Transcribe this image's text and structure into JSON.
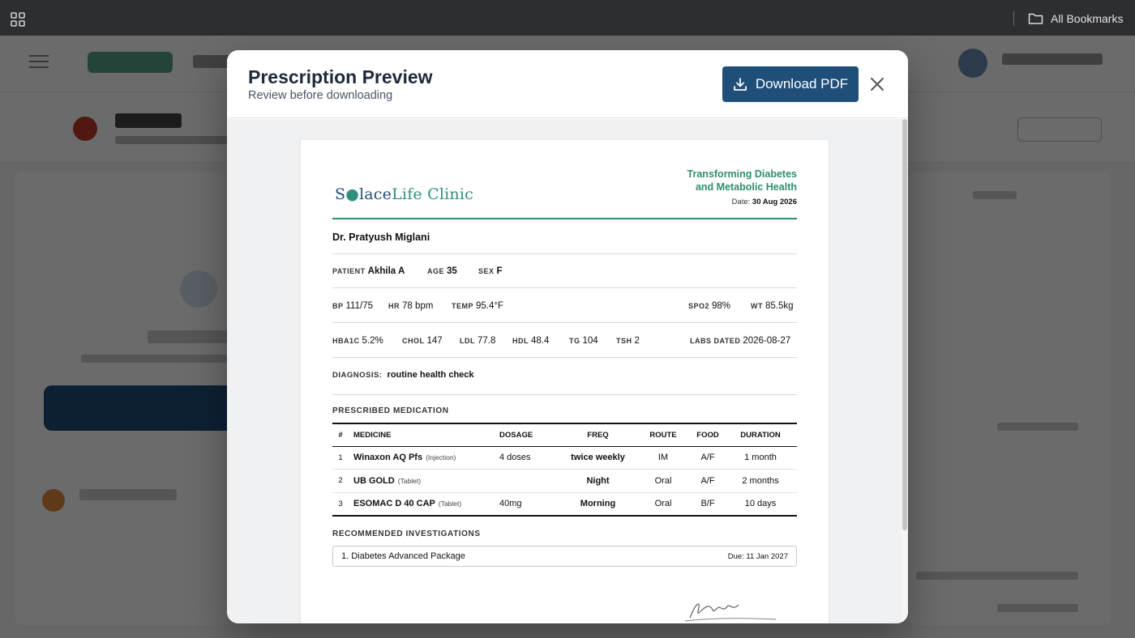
{
  "browser": {
    "bookmarks_label": "All Bookmarks",
    "apps_icon": "apps-grid-icon",
    "folder_icon": "folder-icon"
  },
  "modal": {
    "title": "Prescription Preview",
    "subtitle": "Review before downloading",
    "download_label": "Download PDF",
    "download_icon": "download-icon",
    "close_icon": "close-icon",
    "accent_color": "#1f4e79"
  },
  "prescription": {
    "clinic": {
      "name_part1": "S",
      "name_part2": "lace",
      "name_part3": "Life Clinic",
      "brand_color": "#2f8f6a"
    },
    "tagline_line1": "Transforming Diabetes",
    "tagline_line2": "and Metabolic Health",
    "date_label": "Date:",
    "date_value": "30 Aug 2026",
    "doctor": "Dr. Pratyush Miglani",
    "patient": {
      "patient_label": "PATIENT",
      "patient_value": "Akhila A",
      "age_label": "AGE",
      "age_value": "35",
      "sex_label": "SEX",
      "sex_value": "F"
    },
    "vitals": {
      "bp_label": "BP",
      "bp_value": "111/75",
      "hr_label": "HR",
      "hr_value": "78 bpm",
      "temp_label": "TEMP",
      "temp_value": "95.4°F",
      "spo2_label": "SPO2",
      "spo2_value": "98%",
      "wt_label": "WT",
      "wt_value": "85.5kg"
    },
    "labs": {
      "hba1c_label": "HBA1C",
      "hba1c_value": "5.2%",
      "chol_label": "CHOL",
      "chol_value": "147",
      "ldl_label": "LDL",
      "ldl_value": "77.8",
      "hdl_label": "HDL",
      "hdl_value": "48.4",
      "tg_label": "TG",
      "tg_value": "104",
      "tsh_label": "TSH",
      "tsh_value": "2",
      "dated_label": "LABS DATED",
      "dated_value": "2026-08-27"
    },
    "diagnosis_label": "DIAGNOSIS:",
    "diagnosis_value": "routine health check",
    "medication_heading": "PRESCRIBED MEDICATION",
    "med_columns": {
      "idx": "#",
      "medicine": "MEDICINE",
      "dosage": "DOSAGE",
      "freq": "FREQ",
      "route": "ROUTE",
      "food": "FOOD",
      "duration": "DURATION"
    },
    "medications": [
      {
        "idx": "1",
        "name": "Winaxon AQ Pfs",
        "form": "(Injection)",
        "dosage": "4 doses",
        "freq": "twice weekly",
        "route": "IM",
        "food": "A/F",
        "duration": "1 month"
      },
      {
        "idx": "2",
        "name": "UB GOLD",
        "form": "(Tablet)",
        "dosage": "",
        "freq": "Night",
        "route": "Oral",
        "food": "A/F",
        "duration": "2 months"
      },
      {
        "idx": "3",
        "name": "ESOMAC D 40 CAP",
        "form": "(Tablet)",
        "dosage": "40mg",
        "freq": "Morning",
        "route": "Oral",
        "food": "B/F",
        "duration": "10 days"
      }
    ],
    "investigations_heading": "RECOMMENDED INVESTIGATIONS",
    "investigations": [
      {
        "name": "1. Diabetes Advanced Package",
        "due": "Due: 11 Jan 2027"
      }
    ]
  }
}
